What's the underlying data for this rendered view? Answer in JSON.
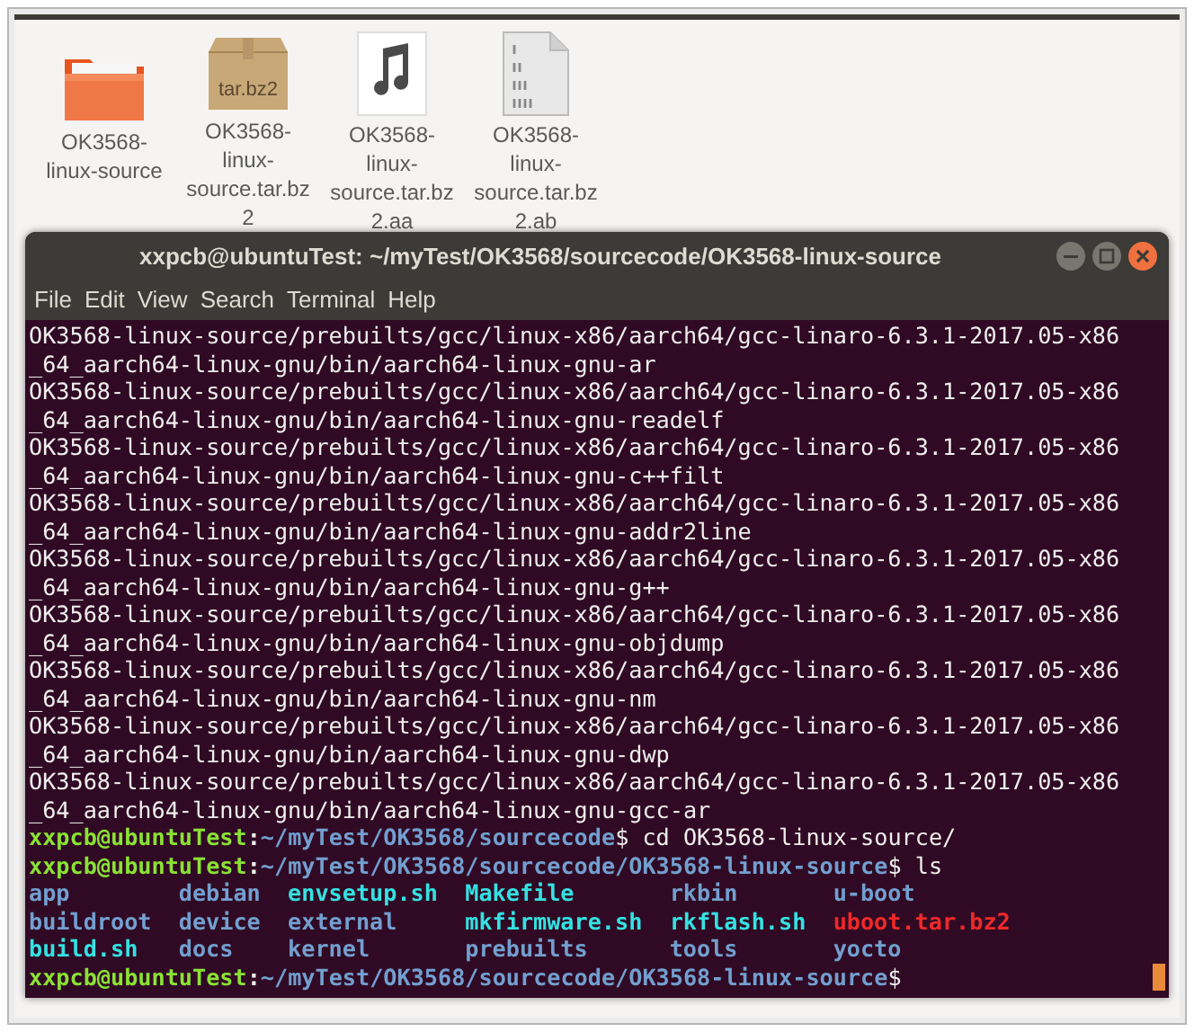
{
  "files": [
    {
      "kind": "folder",
      "label": "OK3568-linux-source"
    },
    {
      "kind": "archive",
      "label": "OK3568-linux-source.tar.bz2",
      "badge": "tar.bz2"
    },
    {
      "kind": "audio",
      "label": "OK3568-linux-source.tar.bz2.aa"
    },
    {
      "kind": "binary",
      "label": "OK3568-linux-source.tar.bz2.ab"
    }
  ],
  "terminal": {
    "title": "xxpcb@ubuntuTest: ~/myTest/OK3568/sourcecode/OK3568-linux-source",
    "menu": [
      "File",
      "Edit",
      "View",
      "Search",
      "Terminal",
      "Help"
    ],
    "output": [
      "OK3568-linux-source/prebuilts/gcc/linux-x86/aarch64/gcc-linaro-6.3.1-2017.05-x86",
      "_64_aarch64-linux-gnu/bin/aarch64-linux-gnu-ar",
      "OK3568-linux-source/prebuilts/gcc/linux-x86/aarch64/gcc-linaro-6.3.1-2017.05-x86",
      "_64_aarch64-linux-gnu/bin/aarch64-linux-gnu-readelf",
      "OK3568-linux-source/prebuilts/gcc/linux-x86/aarch64/gcc-linaro-6.3.1-2017.05-x86",
      "_64_aarch64-linux-gnu/bin/aarch64-linux-gnu-c++filt",
      "OK3568-linux-source/prebuilts/gcc/linux-x86/aarch64/gcc-linaro-6.3.1-2017.05-x86",
      "_64_aarch64-linux-gnu/bin/aarch64-linux-gnu-addr2line",
      "OK3568-linux-source/prebuilts/gcc/linux-x86/aarch64/gcc-linaro-6.3.1-2017.05-x86",
      "_64_aarch64-linux-gnu/bin/aarch64-linux-gnu-g++",
      "OK3568-linux-source/prebuilts/gcc/linux-x86/aarch64/gcc-linaro-6.3.1-2017.05-x86",
      "_64_aarch64-linux-gnu/bin/aarch64-linux-gnu-objdump",
      "OK3568-linux-source/prebuilts/gcc/linux-x86/aarch64/gcc-linaro-6.3.1-2017.05-x86",
      "_64_aarch64-linux-gnu/bin/aarch64-linux-gnu-nm",
      "OK3568-linux-source/prebuilts/gcc/linux-x86/aarch64/gcc-linaro-6.3.1-2017.05-x86",
      "_64_aarch64-linux-gnu/bin/aarch64-linux-gnu-dwp",
      "OK3568-linux-source/prebuilts/gcc/linux-x86/aarch64/gcc-linaro-6.3.1-2017.05-x86",
      "_64_aarch64-linux-gnu/bin/aarch64-linux-gnu-gcc-ar"
    ],
    "prompt1": {
      "user": "xxpcb@ubuntuTest",
      "separator": ":",
      "path": "~/myTest/OK3568/sourcecode",
      "command": "$ cd OK3568-linux-source/"
    },
    "prompt2": {
      "user": "xxpcb@ubuntuTest",
      "separator": ":",
      "path": "~/myTest/OK3568/sourcecode/OK3568-linux-source",
      "command": "$ ls"
    },
    "listing": [
      {
        "name": "app",
        "kind": "dir"
      },
      {
        "name": "debian",
        "kind": "dir"
      },
      {
        "name": "envsetup.sh",
        "kind": "exec"
      },
      {
        "name": "Makefile",
        "kind": "link"
      },
      {
        "name": "rkbin",
        "kind": "dir"
      },
      {
        "name": "u-boot",
        "kind": "dir"
      },
      {
        "name": "buildroot",
        "kind": "dir"
      },
      {
        "name": "device",
        "kind": "dir"
      },
      {
        "name": "external",
        "kind": "dir"
      },
      {
        "name": "mkfirmware.sh",
        "kind": "exec"
      },
      {
        "name": "rkflash.sh",
        "kind": "exec"
      },
      {
        "name": "uboot.tar.bz2",
        "kind": "archive"
      },
      {
        "name": "build.sh",
        "kind": "exec"
      },
      {
        "name": "docs",
        "kind": "dir"
      },
      {
        "name": "kernel",
        "kind": "dir"
      },
      {
        "name": "prebuilts",
        "kind": "dir"
      },
      {
        "name": "tools",
        "kind": "dir"
      },
      {
        "name": "yocto",
        "kind": "dir"
      }
    ],
    "prompt3": {
      "user": "xxpcb@ubuntuTest",
      "separator": ":",
      "path": "~/myTest/OK3568/sourcecode/OK3568-linux-source",
      "command": "$"
    }
  }
}
